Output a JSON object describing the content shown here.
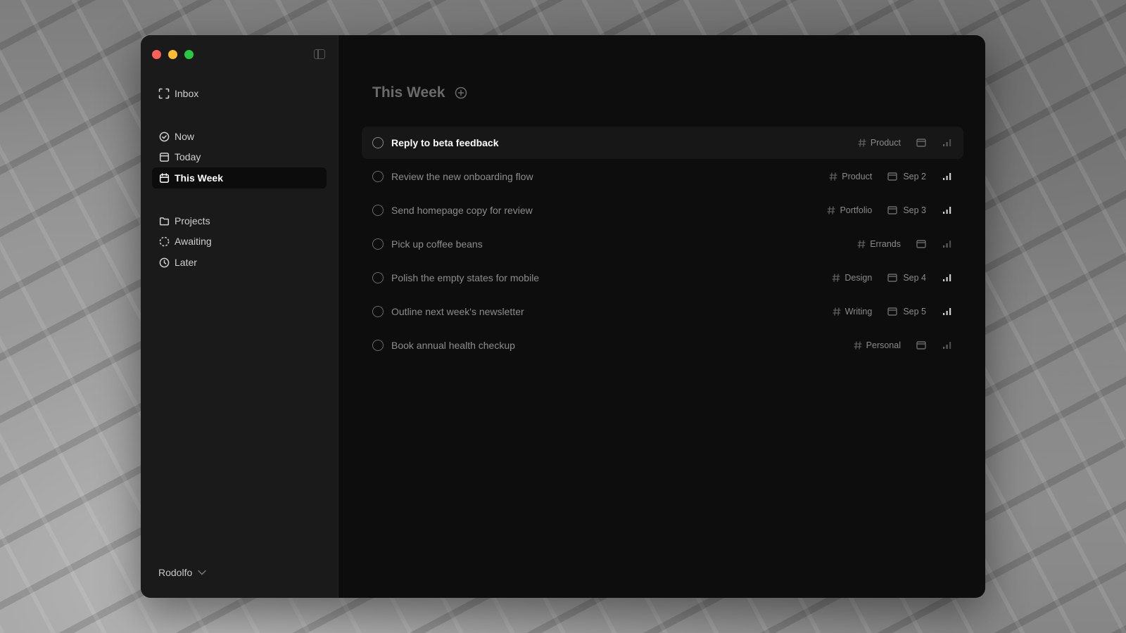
{
  "window": {
    "title": "This Week"
  },
  "sidebar": {
    "inbox": {
      "label": "Inbox",
      "icon": "inbox-icon"
    },
    "views": [
      {
        "label": "Now",
        "icon": "check-circle-icon"
      },
      {
        "label": "Today",
        "icon": "calendar-icon"
      },
      {
        "label": "This Week",
        "icon": "calendar-week-icon",
        "active": true
      }
    ],
    "groups": [
      {
        "label": "Projects",
        "icon": "folder-icon"
      },
      {
        "label": "Awaiting",
        "icon": "dashed-circle-icon"
      },
      {
        "label": "Later",
        "icon": "clock-icon"
      }
    ],
    "user": {
      "name": "Rodolfo",
      "icon": "chevron-down-icon"
    }
  },
  "main": {
    "title": "This Week",
    "tasks": [
      {
        "title": "Reply to beta feedback",
        "tag": "Product",
        "date": "",
        "highlight": true
      },
      {
        "title": "Review the new onboarding flow",
        "tag": "Product",
        "date": "Sep 2"
      },
      {
        "title": "Send homepage copy for review",
        "tag": "Portfolio",
        "date": "Sep 3"
      },
      {
        "title": "Pick up coffee beans",
        "tag": "Errands",
        "date": ""
      },
      {
        "title": "Polish the empty states for mobile",
        "tag": "Design",
        "date": "Sep 4"
      },
      {
        "title": "Outline next week's newsletter",
        "tag": "Writing",
        "date": "Sep 5"
      },
      {
        "title": "Book annual health checkup",
        "tag": "Personal",
        "date": ""
      }
    ]
  },
  "colors": {
    "accent_active": "#ffffff",
    "sidebar_bg": "#1a1a1a",
    "main_bg": "#0d0d0d",
    "traffic_red": "#fe5f57",
    "traffic_yellow": "#febc2e",
    "traffic_green": "#28c840"
  }
}
